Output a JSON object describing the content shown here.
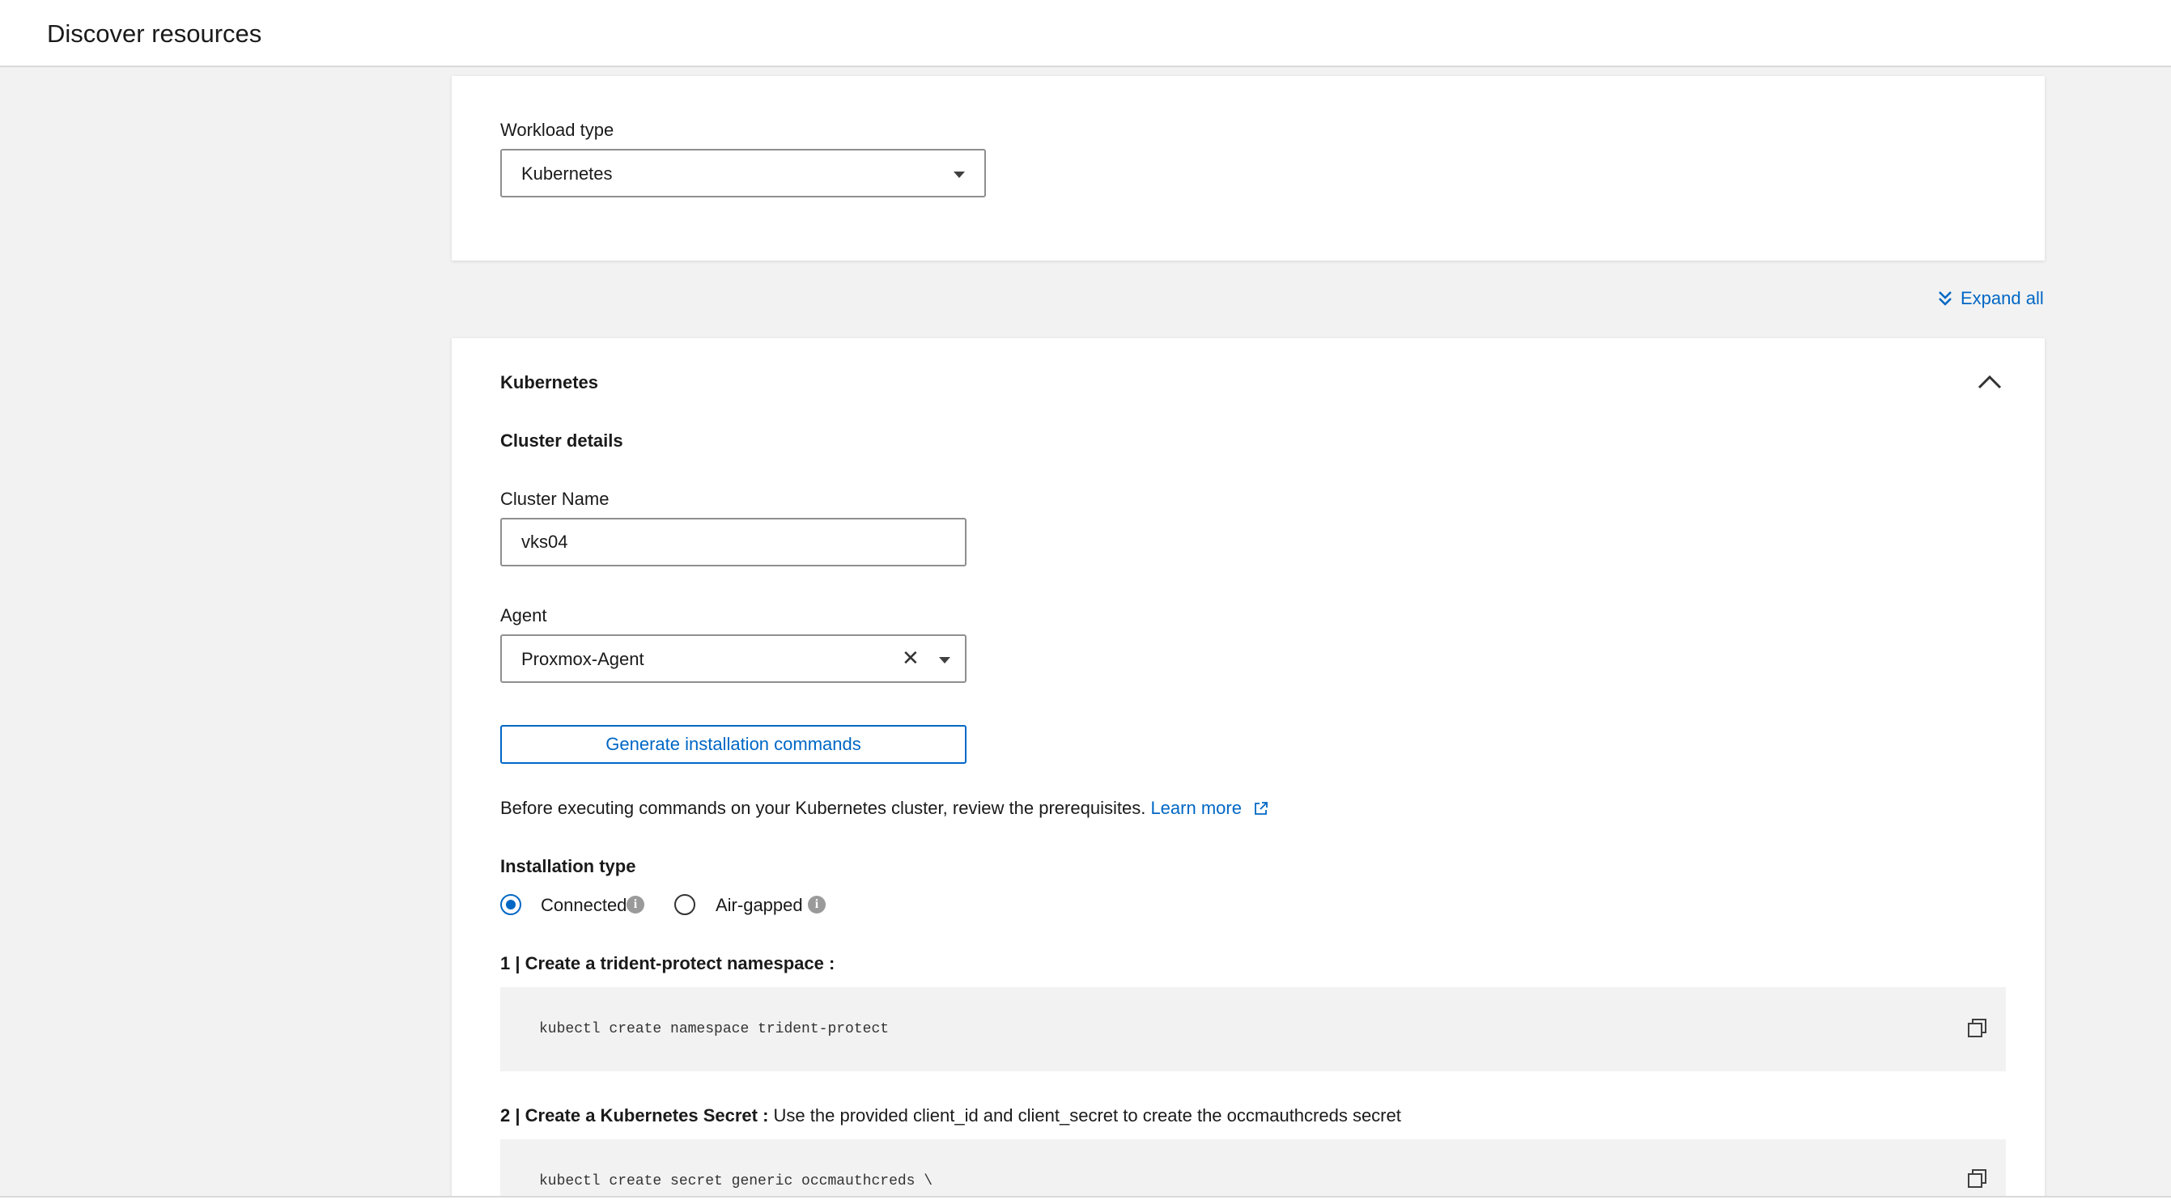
{
  "header": {
    "title": "Discover resources"
  },
  "workload": {
    "label": "Workload type",
    "value": "Kubernetes"
  },
  "expand_all": {
    "label": "Expand all"
  },
  "section": {
    "title": "Kubernetes",
    "cluster_details": "Cluster details",
    "cluster_name_label": "Cluster Name",
    "cluster_name_value": "vks04",
    "agent_label": "Agent",
    "agent_value": "Proxmox-Agent",
    "generate_button": "Generate installation commands",
    "prereq_text": "Before executing commands on your Kubernetes cluster, review the prerequisites.",
    "learn_more": "Learn more",
    "installation_type_label": "Installation type",
    "radio_connected": "Connected",
    "radio_airgapped": "Air-gapped",
    "step1_prefix": "1 | Create a trident-protect namespace :",
    "step1_code": "kubectl create namespace trident-protect",
    "step2_prefix": "2 | Create a Kubernetes Secret :",
    "step2_text": "Use the provided client_id and client_secret to create the occmauthcreds secret",
    "step2_code": "kubectl create secret generic occmauthcreds \\"
  },
  "colors": {
    "accent": "#0067c5",
    "background": "#f2f2f2"
  },
  "icons": {
    "caret": "chevron-down-icon",
    "expand": "chevrons-down-icon",
    "collapse": "chevron-up-icon",
    "clear": "close-icon",
    "external": "external-link-icon",
    "info": "info-icon",
    "copy": "copy-icon"
  }
}
